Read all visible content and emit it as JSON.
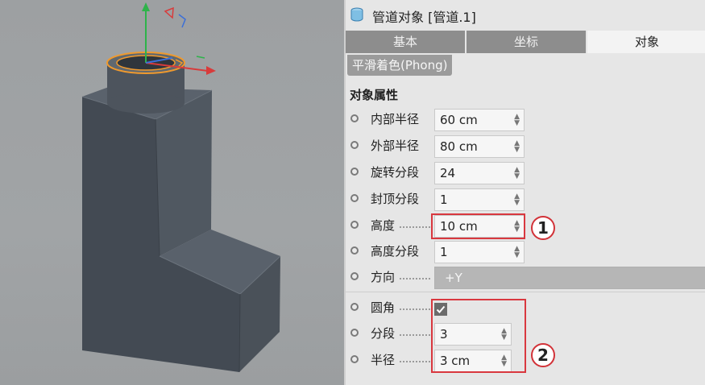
{
  "panel": {
    "title": "管道对象 [管道.1]",
    "tabs": [
      {
        "label": "基本",
        "active": false
      },
      {
        "label": "坐标",
        "active": false
      },
      {
        "label": "对象",
        "active": true
      }
    ],
    "subtab": "平滑着色(Phong)",
    "section_title": "对象属性",
    "properties": [
      {
        "label": "内部半径",
        "value": "60 cm"
      },
      {
        "label": "外部半径",
        "value": "80 cm"
      },
      {
        "label": "旋转分段",
        "value": "24"
      },
      {
        "label": "封顶分段",
        "value": "1"
      },
      {
        "label": "高度",
        "value": "10 cm"
      },
      {
        "label": "高度分段",
        "value": "1"
      },
      {
        "label": "方向",
        "value": "+Y"
      }
    ],
    "fillet": {
      "label": "圆角",
      "checked": true,
      "segments_label": "分段",
      "segments_value": "3",
      "radius_label": "半径",
      "radius_value": "3 cm"
    }
  },
  "callouts": [
    "1",
    "2"
  ],
  "colors": {
    "highlight": "#d9383f",
    "tab_active": "#f3f3f3",
    "tab_inactive": "#8d8d8d"
  }
}
